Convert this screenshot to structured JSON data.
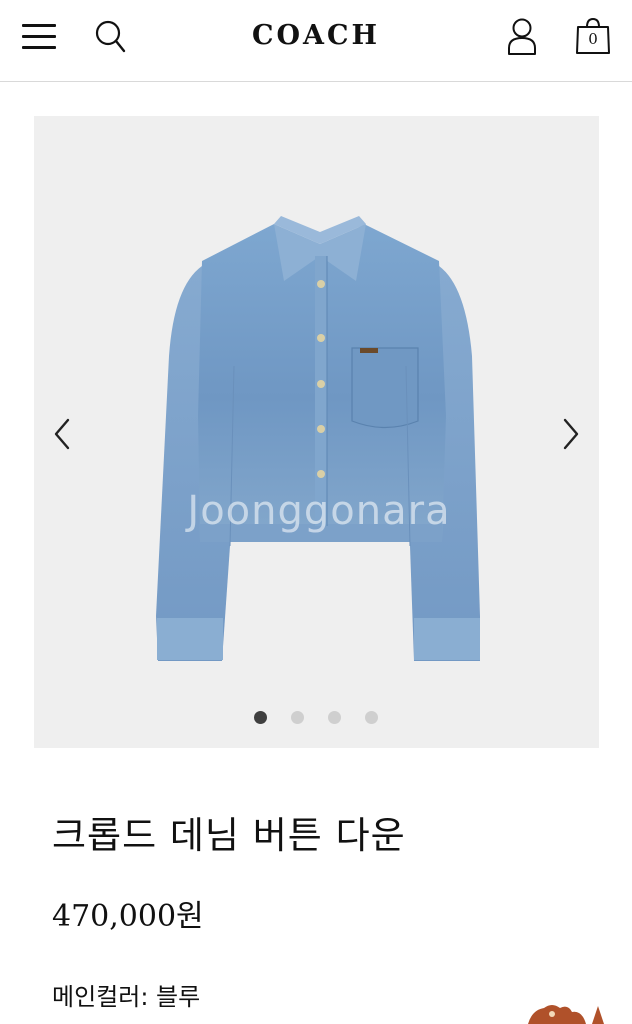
{
  "header": {
    "logo": "COACH",
    "bag_count": "0"
  },
  "icons": {
    "menu": "hamburger-menu-icon",
    "search": "search-icon",
    "account": "user-icon",
    "bag": "shopping-bag-icon",
    "prev": "chevron-left-icon",
    "next": "chevron-right-icon"
  },
  "gallery": {
    "watermark": "Joonggonara",
    "image_count": 4,
    "active_index": 0
  },
  "product": {
    "title": "크롭드 데님 버튼 다운",
    "price": "470,000원",
    "color": "메인컬러: 블루"
  },
  "colors": {
    "accent": "#111111",
    "image_bg": "#efefef",
    "denim": "#7ea3cb",
    "dot_active": "#3f3f3f",
    "dot_inactive": "#cfcfcf"
  }
}
